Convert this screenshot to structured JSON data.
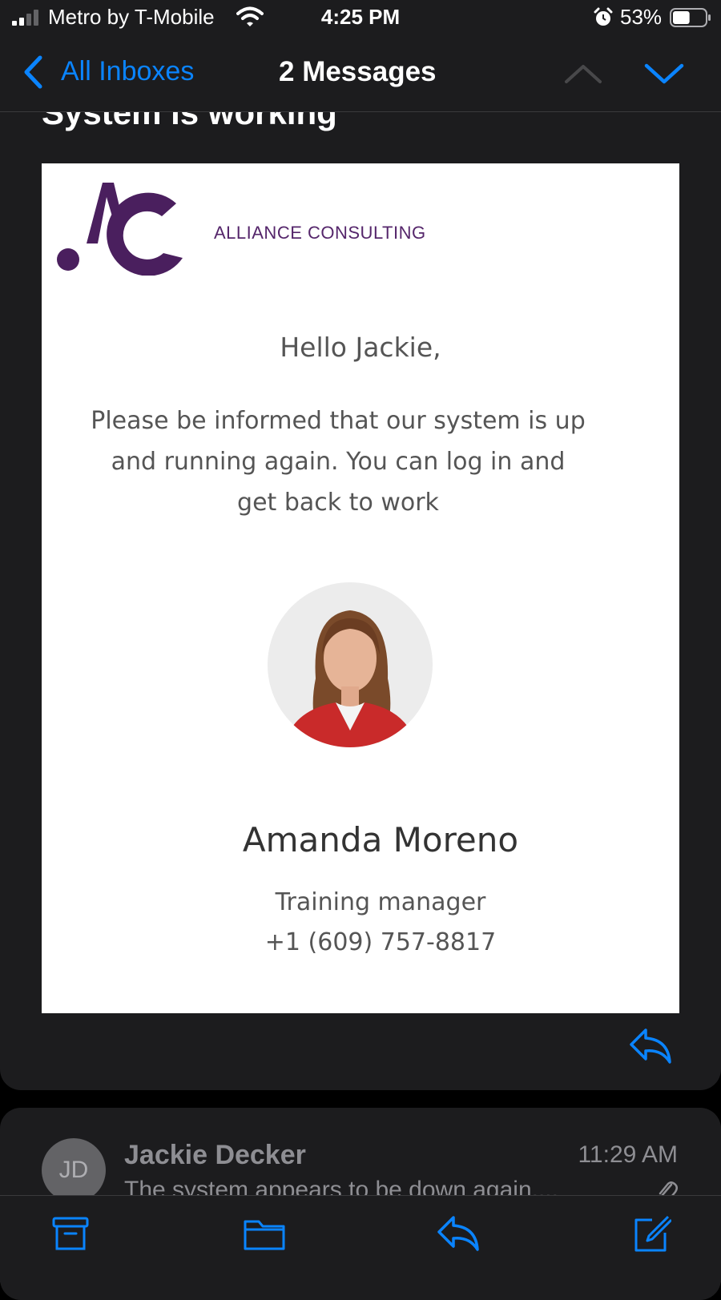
{
  "status_bar": {
    "carrier": "Metro by T-Mobile",
    "time": "4:25 PM",
    "battery_percent": "53%",
    "battery_level": 0.53
  },
  "nav": {
    "back_label": "All Inboxes",
    "title": "2 Messages"
  },
  "message": {
    "subject": "System is working",
    "logo_text": "ALLIANCE CONSULTING",
    "greeting": "Hello Jackie,",
    "body": "Please be informed that our system is up and running again. You can log in and get back to work",
    "signature": {
      "name": "Amanda Moreno",
      "title": "Training manager",
      "phone": "+1 (609) 757-8817"
    }
  },
  "preview": {
    "initials": "JD",
    "sender": "Jackie Decker",
    "time": "11:29 AM",
    "snippet": "The system appears to be down again...."
  },
  "icons": {
    "accent": "#0a84ff",
    "brand": "#55266b",
    "toolbar": [
      "archive-icon",
      "folder-icon",
      "reply-icon",
      "compose-icon"
    ]
  }
}
